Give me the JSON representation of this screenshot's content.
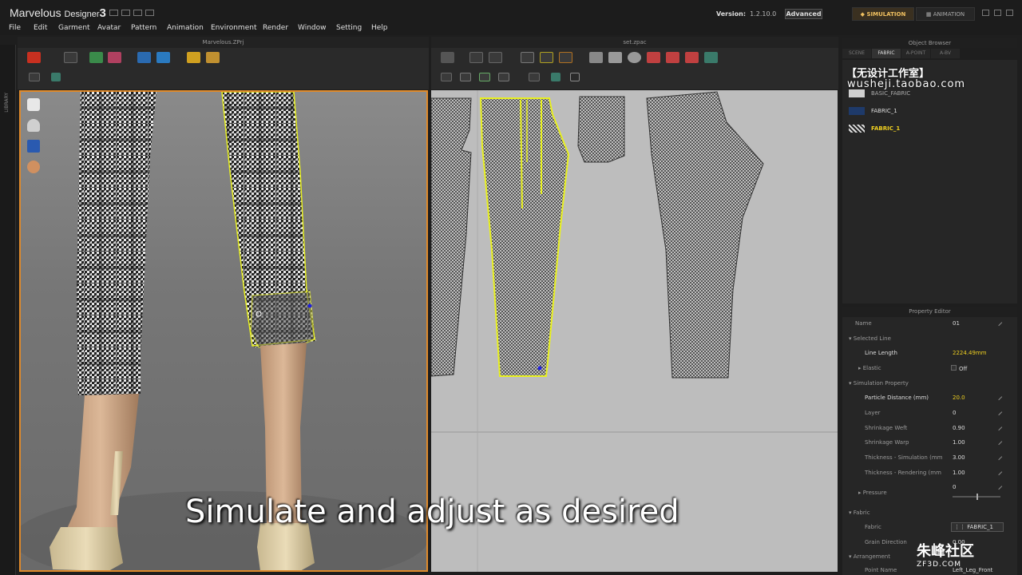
{
  "app": {
    "title_main": "Marvelous",
    "title_sub": "Designer",
    "title_num": "3",
    "version_label": "Version:",
    "version_value": "1.2.10.0",
    "advanced_label": "Advanced",
    "simulation_label": "SIMULATION",
    "animation_label": "ANIMATION"
  },
  "menu": [
    "File",
    "Edit",
    "Garment",
    "Avatar",
    "Pattern",
    "Animation",
    "Environment",
    "Render",
    "Window",
    "Setting",
    "Help"
  ],
  "tabs": {
    "view3d": "Marvelous.ZPrj",
    "view2d": "set.zpac",
    "object_browser": "Object Browser",
    "property_editor": "Property Editor",
    "library": "LIBRARY"
  },
  "object_browser": {
    "tabs": [
      "SCENE",
      "FABRIC",
      "A-POINT",
      "A-BV"
    ],
    "active_tab": "FABRIC",
    "fabrics": [
      {
        "name": "BASIC_FABRIC",
        "color": "#d0d0d0"
      },
      {
        "name": "FABRIC_1",
        "color": "#1e3a6a"
      },
      {
        "name": "FABRIC_1",
        "color": "#888888",
        "selected": true
      }
    ]
  },
  "watermark": {
    "line1": "【无设计工作室】",
    "line2": "wusheji.taobao.com"
  },
  "property_editor": {
    "rows": [
      {
        "label": "Name",
        "value": "01",
        "type": "field"
      },
      {
        "label": "Selected Line",
        "value": "",
        "type": "section"
      },
      {
        "label": "Line Length",
        "value": "2224.49mm",
        "type": "highlight"
      },
      {
        "label": "Elastic",
        "value": "Off",
        "type": "field"
      },
      {
        "label": "Simulation Property",
        "value": "",
        "type": "section"
      },
      {
        "label": "Particle Distance (mm)",
        "value": "20.0",
        "type": "highlight"
      },
      {
        "label": "Layer",
        "value": "0",
        "type": "field"
      },
      {
        "label": "Shrinkage Weft",
        "value": "0.90",
        "type": "field"
      },
      {
        "label": "Shrinkage Warp",
        "value": "1.00",
        "type": "field"
      },
      {
        "label": "Thickness - Simulation (mm",
        "value": "3.00",
        "type": "field"
      },
      {
        "label": "Thickness - Rendering (mm",
        "value": "1.00",
        "type": "field"
      },
      {
        "label": "Pressure",
        "value": "0",
        "type": "field"
      },
      {
        "label": "Fabric",
        "value": "",
        "type": "section"
      },
      {
        "label": "Fabric",
        "value": "FABRIC_1",
        "type": "field"
      },
      {
        "label": "Grain Direction",
        "value": "0.00",
        "type": "field"
      },
      {
        "label": "Arrangement",
        "value": "",
        "type": "section"
      },
      {
        "label": "Point Name",
        "value": "Left_Leg_Front",
        "type": "field"
      }
    ]
  },
  "caption": "Simulate and adjust as desired",
  "logo": {
    "line1": "朱峰社区",
    "line2": "ZF3D.COM"
  }
}
